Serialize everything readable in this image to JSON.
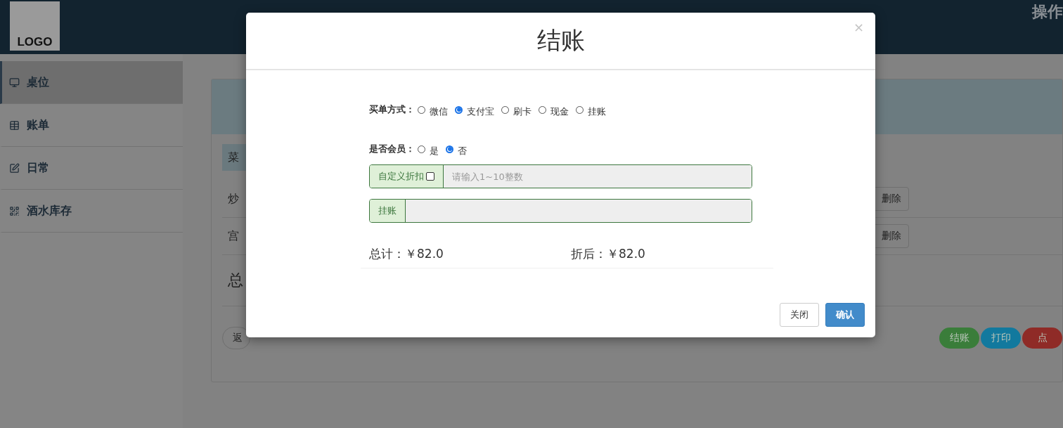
{
  "header": {
    "logo": "LOGO",
    "operator": "操作"
  },
  "sidebar": {
    "items": [
      {
        "label": "桌位",
        "selected": true
      },
      {
        "label": "账单",
        "selected": false
      },
      {
        "label": "日常",
        "selected": false
      },
      {
        "label": "酒水库存",
        "selected": false
      }
    ]
  },
  "table": {
    "column_1": "菜",
    "rows": [
      {
        "name": "炒",
        "action": "删除"
      },
      {
        "name": "宫",
        "action": "删除"
      }
    ],
    "total": "总",
    "back": "返"
  },
  "actions": [
    {
      "label": "结账",
      "color": "#3a7d3a"
    },
    {
      "label": "打印",
      "color": "#12799e"
    },
    {
      "label": "点",
      "color": "#8f2b27"
    }
  ],
  "modal": {
    "title": "结账",
    "close": "×",
    "payment": {
      "label": "买单方式：",
      "options": [
        {
          "label": "微信",
          "selected": false
        },
        {
          "label": "支付宝",
          "selected": true
        },
        {
          "label": "刷卡",
          "selected": false
        },
        {
          "label": "现金",
          "selected": false
        },
        {
          "label": "挂账",
          "selected": false
        }
      ]
    },
    "member": {
      "label": "是否会员：",
      "options": [
        {
          "label": "是",
          "selected": false
        },
        {
          "label": "否",
          "selected": true
        }
      ]
    },
    "discount": {
      "label": "自定义折扣",
      "checked": false,
      "placeholder": "请输入1~10整数"
    },
    "credit": {
      "label": "挂账"
    },
    "total": "总计：￥82.0",
    "discounted": "折后：￥82.0",
    "buttons": [
      {
        "label": "关闭",
        "kind": "default"
      },
      {
        "label": "确认",
        "kind": "primary"
      }
    ]
  }
}
